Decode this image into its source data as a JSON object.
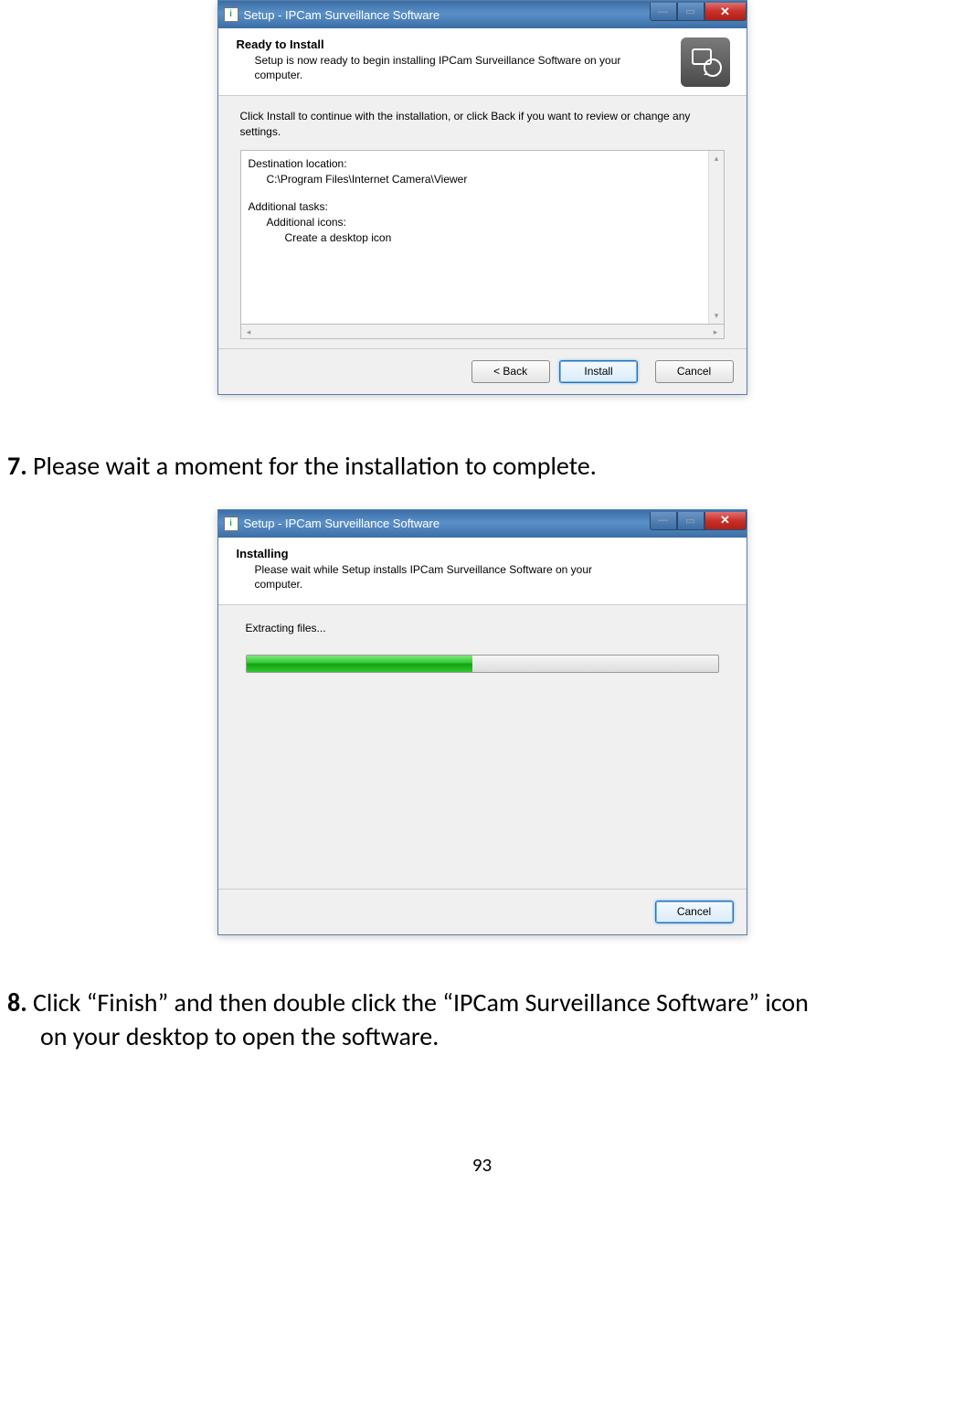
{
  "win1": {
    "title": "Setup - IPCam Surveillance Software",
    "header_title": "Ready to Install",
    "header_sub": "Setup is now ready to begin installing IPCam Surveillance Software on your computer.",
    "instruction": "Click Install to continue with the installation, or click Back if you want to review or change any settings.",
    "summary": {
      "dest_label": "Destination location:",
      "dest_path": "C:\\Program Files\\Internet Camera\\Viewer",
      "tasks_label": "Additional tasks:",
      "icons_label": "Additional icons:",
      "desktop_icon": "Create a desktop icon"
    },
    "buttons": {
      "back": "< Back",
      "install": "Install",
      "cancel": "Cancel"
    }
  },
  "step7": {
    "num": "7.",
    "text": " Please wait a moment for the installation to complete."
  },
  "win2": {
    "title": "Setup - IPCam Surveillance Software",
    "header_title": "Installing",
    "header_sub": "Please wait while Setup installs IPCam Surveillance Software on your computer.",
    "progress_label": "Extracting files...",
    "progress_percent": 48,
    "buttons": {
      "cancel": "Cancel"
    }
  },
  "step8": {
    "num": "8.",
    "text": " Click “Finish” and then double click the “IPCam Surveillance Software” icon",
    "cont": "on your desktop to open the software."
  },
  "page_number": "93"
}
